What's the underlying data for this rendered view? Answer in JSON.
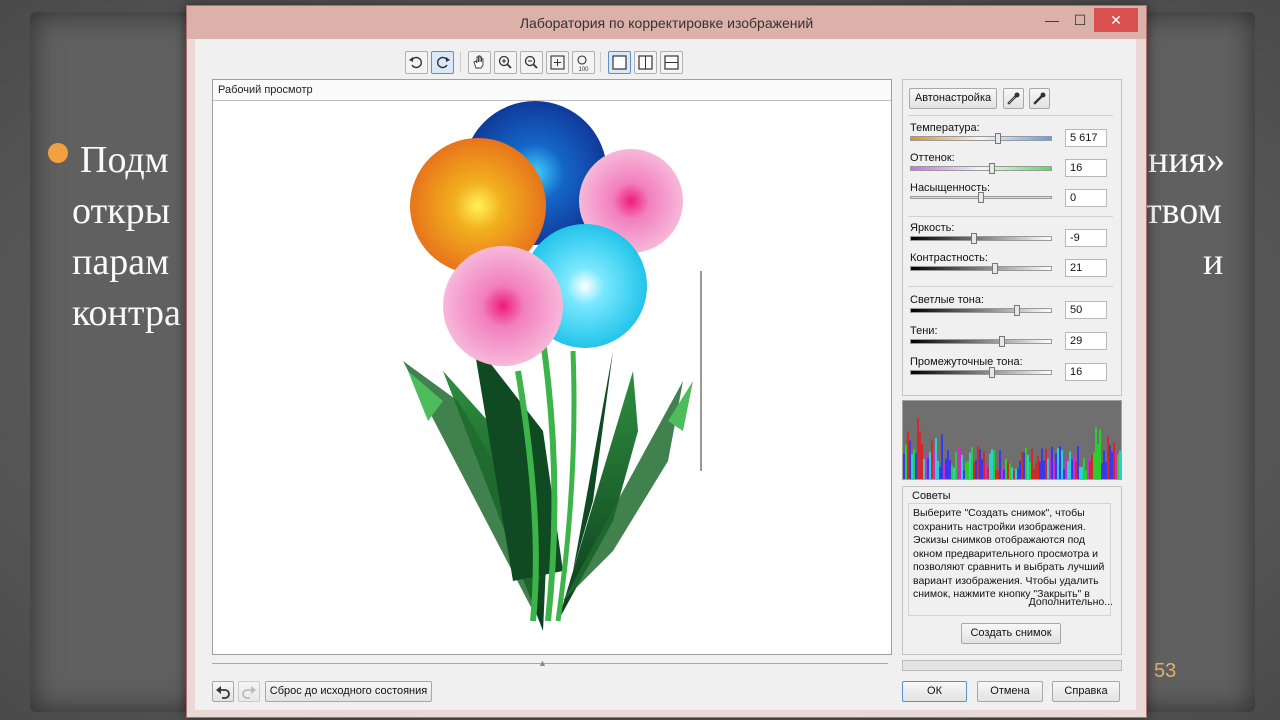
{
  "slide": {
    "lines": [
      "Подм",
      "откры",
      "парам",
      "контра"
    ],
    "right_fragments": [
      "ния»",
      "твом",
      "и"
    ],
    "page_number": "53"
  },
  "window": {
    "title": "Лаборатория по корректировке изображений",
    "controls": {
      "minimize": "—",
      "maximize": "☐",
      "close": "✕"
    }
  },
  "toolbar": {
    "tools": [
      "rotate-left-icon",
      "rotate-right-icon",
      "hand-pan-icon",
      "zoom-in-icon",
      "zoom-out-icon",
      "fit-to-window-icon",
      "actual-size-100-icon",
      "single-view-icon",
      "split-view-vertical-icon",
      "split-view-horizontal-icon"
    ],
    "zoom_100_label": "100"
  },
  "preview": {
    "label": "Рабочий просмотр"
  },
  "panel": {
    "auto_button": "Автонастройка",
    "sliders": [
      {
        "label": "Температура:",
        "value": "5 617",
        "position": 0.62
      },
      {
        "label": "Оттенок:",
        "value": "16",
        "position": 0.58
      },
      {
        "label": "Насыщенность:",
        "value": "0",
        "position": 0.5
      },
      {
        "label": "Яркость:",
        "value": "-9",
        "position": 0.45
      },
      {
        "label": "Контрастность:",
        "value": "21",
        "position": 0.6
      },
      {
        "label": "Светлые тона:",
        "value": "50",
        "position": 0.75
      },
      {
        "label": "Тени:",
        "value": "29",
        "position": 0.65
      },
      {
        "label": "Промежуточные тона:",
        "value": "16",
        "position": 0.58
      }
    ]
  },
  "tips": {
    "title": "Советы",
    "text": "Выберите \"Создать снимок\", чтобы сохранить настройки изображения. Эскизы снимков отображаются под окном предварительного просмотра и позволяют сравнить и выбрать лучший вариант изображения. Чтобы удалить снимок, нажмите кнопку \"Закрыть\" в",
    "more": "Дополнительно...",
    "snapshot_button": "Создать снимок"
  },
  "bottom": {
    "reset_button": "Сброс до исходного состояния",
    "ok": "ОК",
    "cancel": "Отмена",
    "help": "Справка"
  },
  "colors": {
    "title_bar": "#dbb1aa",
    "close_button": "#d85050",
    "slide_bullet": "#f0a040",
    "slide_page": "#e0b070"
  }
}
